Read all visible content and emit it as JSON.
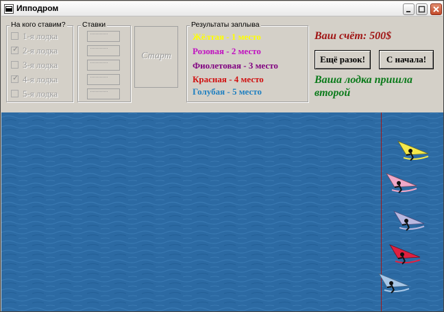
{
  "window": {
    "title": "Ипподром",
    "icons": [
      "app-icon",
      "minimize-icon",
      "maximize-icon",
      "close-icon"
    ]
  },
  "bet_on": {
    "title": "На кого ставим?",
    "boats": [
      {
        "label": "1-я лодка",
        "checked": false
      },
      {
        "label": "2-я лодка",
        "checked": true
      },
      {
        "label": "3-я лодка",
        "checked": false
      },
      {
        "label": "4-я лодка",
        "checked": true
      },
      {
        "label": "5-я лодка",
        "checked": false
      }
    ]
  },
  "stakes": {
    "title": "Ставки",
    "fields": [
      "·············",
      "·············",
      "·············",
      "·············",
      "·············"
    ]
  },
  "start_button": {
    "label": "Старт"
  },
  "results": {
    "title": "Результаты заплыва",
    "items": [
      {
        "text": "Жёлтая - 1 место",
        "color": "#ffff00"
      },
      {
        "text": "Розовая - 2 место",
        "color": "#c010c0"
      },
      {
        "text": "Фиолетовая - 3 место",
        "color": "#800080"
      },
      {
        "text": "Красная - 4 место",
        "color": "#d01010"
      },
      {
        "text": "Голубая - 5 место",
        "color": "#2080c0"
      }
    ]
  },
  "score": {
    "text": "Ваш счёт: 500$"
  },
  "buttons": {
    "again": "Ещё разок!",
    "restart": "С начала!"
  },
  "message": {
    "text": "Ваша лодка пришла второй"
  },
  "race": {
    "water_color": "#2c6aa3",
    "finish_line_color": "#a01818",
    "boats": [
      {
        "name": "yellow-boat",
        "sail_color": "#f5e84a"
      },
      {
        "name": "pink-boat",
        "sail_color": "#f0a8c8"
      },
      {
        "name": "violet-boat",
        "sail_color": "#b8b8e0"
      },
      {
        "name": "red-boat",
        "sail_color": "#e02040"
      },
      {
        "name": "blue-boat",
        "sail_color": "#a8c8e8"
      }
    ]
  }
}
